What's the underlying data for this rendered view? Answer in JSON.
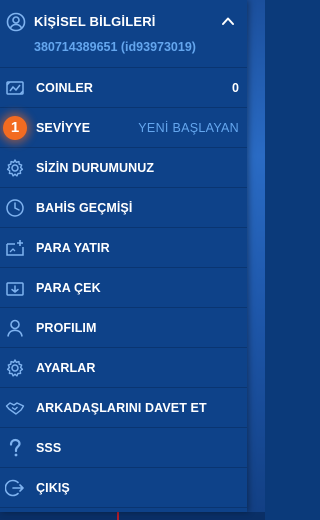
{
  "header": {
    "title": "KİŞİSEL BİLGİLERİ",
    "account": "380714389651 (id93973019)"
  },
  "menu": {
    "items": [
      {
        "label": "COINLER",
        "value": "0",
        "icon": "coins-icon"
      },
      {
        "label": "SEVİYYE",
        "value": "YENİ BAŞLAYAN",
        "badge": "1",
        "icon": "level-badge"
      },
      {
        "label": "SİZİN DURUMUNUZ",
        "icon": "gear-icon"
      },
      {
        "label": "BAHİS GEÇMİŞİ",
        "icon": "clock-icon"
      },
      {
        "label": "PARA YATIR",
        "icon": "deposit-icon"
      },
      {
        "label": "PARA ÇEK",
        "icon": "withdraw-icon"
      },
      {
        "label": "PROFILIM",
        "icon": "person-icon"
      },
      {
        "label": "AYARLAR",
        "icon": "settings-icon"
      },
      {
        "label": "ARKADAŞLARINI DAVET ET",
        "icon": "handshake-icon"
      },
      {
        "label": "SSS",
        "icon": "question-icon"
      },
      {
        "label": "ÇIKIŞ",
        "icon": "logout-icon"
      }
    ]
  },
  "colors": {
    "panel": "#0e4289",
    "divider": "#0a3571",
    "accent_text": "#64a6ee",
    "badge": "#f36b21",
    "text": "#ffffff"
  }
}
